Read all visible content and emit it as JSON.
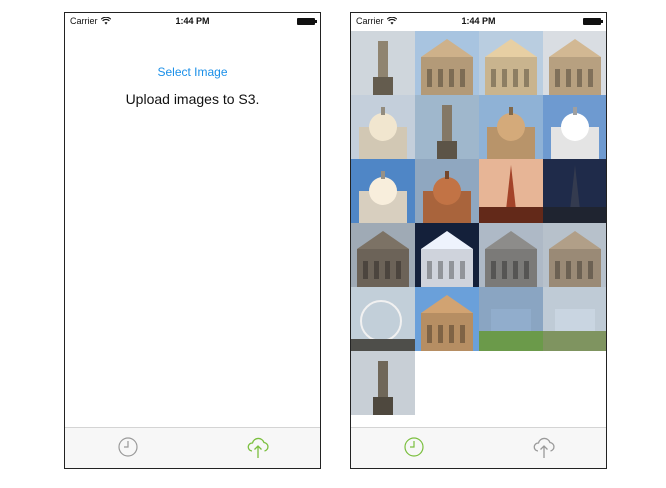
{
  "left_screen": {
    "status": {
      "carrier": "Carrier",
      "time": "1:44 PM"
    },
    "select_button": "Select Image",
    "message": "Upload images to S3.",
    "tabs": [
      {
        "icon": "clock-icon",
        "active": false,
        "color": "#9a9a9a"
      },
      {
        "icon": "cloud-upload-icon",
        "active": true,
        "color": "#7bbf3f"
      }
    ]
  },
  "right_screen": {
    "status": {
      "carrier": "Carrier",
      "time": "1:44 PM"
    },
    "thumbnails": [
      {
        "subject": "statue",
        "sky": "#cfd6dc",
        "base": "#8f8470"
      },
      {
        "subject": "colosseum",
        "sky": "#a8c4e0",
        "base": "#b39a78"
      },
      {
        "subject": "triumphal-arch",
        "sky": "#b9cde0",
        "base": "#c9b48e"
      },
      {
        "subject": "church-facade",
        "sky": "#d9dde2",
        "base": "#b7a080"
      },
      {
        "subject": "domed-cathedral",
        "sky": "#c4cfdb",
        "base": "#d2c8b4"
      },
      {
        "subject": "column",
        "sky": "#9fb7cc",
        "base": "#847866"
      },
      {
        "subject": "round-castle",
        "sky": "#8fb2d6",
        "base": "#b8946a"
      },
      {
        "subject": "basilica",
        "sky": "#6e9ad0",
        "base": "#e4e4e4"
      },
      {
        "subject": "domed-mosque",
        "sky": "#4f86c6",
        "base": "#d8cfbf"
      },
      {
        "subject": "florence-dome",
        "sky": "#8fa7c0",
        "base": "#a9643c"
      },
      {
        "subject": "palace-tower",
        "sky": "#e7b596",
        "base": "#8e3a24"
      },
      {
        "subject": "eiffel-night",
        "sky": "#1f2b4a",
        "base": "#2d3345"
      },
      {
        "subject": "gothic-church",
        "sky": "#9faab5",
        "base": "#6c6358"
      },
      {
        "subject": "milan-cathedral-night",
        "sky": "#14203a",
        "base": "#cfd3dc"
      },
      {
        "subject": "gothic-cathedral",
        "sky": "#aeb9c6",
        "base": "#7b7a78"
      },
      {
        "subject": "gallery-arch",
        "sky": "#b7c1cb",
        "base": "#9a8a76"
      },
      {
        "subject": "ferris-wheel",
        "sky": "#c2cfd9",
        "base": "#6f6f6a"
      },
      {
        "subject": "spired-church",
        "sky": "#6aa0da",
        "base": "#b68e63"
      },
      {
        "subject": "fountain-plaza",
        "sky": "#8aa5c2",
        "base": "#6b9a4a"
      },
      {
        "subject": "hill-castle",
        "sky": "#bfcbd6",
        "base": "#7f9460"
      },
      {
        "subject": "equestrian-statue",
        "sky": "#c8cfd6",
        "base": "#6f6759"
      }
    ],
    "tabs": [
      {
        "icon": "clock-icon",
        "active": true,
        "color": "#7bbf3f"
      },
      {
        "icon": "cloud-upload-icon",
        "active": false,
        "color": "#9a9a9a"
      }
    ]
  }
}
